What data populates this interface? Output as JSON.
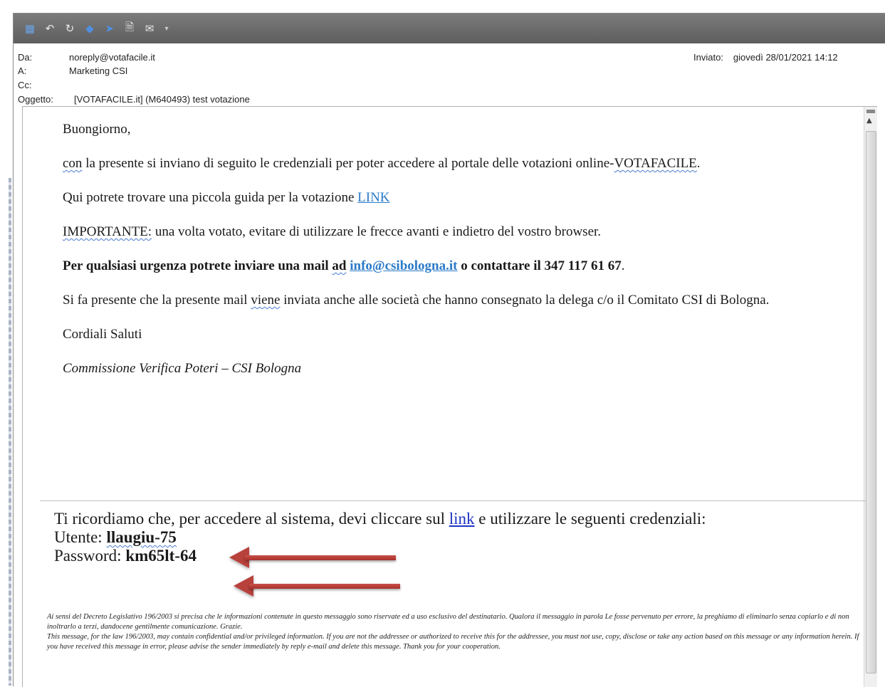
{
  "toolbar": {
    "icons": [
      "save-icon",
      "undo-icon",
      "redo-icon",
      "previous-icon",
      "next-icon",
      "attachment-icon",
      "fax-icon",
      "customize-dropdown-icon"
    ]
  },
  "header": {
    "from_label": "Da:",
    "from_value": "noreply@votafacile.it",
    "to_label": "A:",
    "to_value": "Marketing CSI",
    "cc_label": "Cc:",
    "cc_value": "",
    "subject_label": "Oggetto:",
    "subject_value": "[VOTAFACILE.it] (M640493) test votazione",
    "sent_label": "Inviato:",
    "sent_value": "giovedì 28/01/2021 14:12"
  },
  "message": {
    "greeting": "Buongiorno,",
    "p1_a": "con",
    "p1_b": " la presente si inviano di seguito le credenziali per poter accedere al portale delle votazioni online-",
    "p1_c": "VOTAFACILE",
    "p1_d": ".",
    "p2_a": "Qui potrete trovare una piccola guida per la votazione ",
    "p2_link": "LINK",
    "p3_a": "IMPORTANTE:",
    "p3_b": " una volta votato, evitare di utilizzare  le frecce avanti e indietro  del vostro browser.",
    "p4_a": "Per qualsiasi urgenza potrete inviare una mail ",
    "p4_ad": "ad",
    "p4_space": " ",
    "p4_email": "info@csibologna.it",
    "p4_b": " o contattare il 347 117 61 67",
    "p4_dot": ".",
    "p5_a": "Si fa presente che la presente mail ",
    "p5_viene": "viene",
    "p5_b": " inviata anche alle società che hanno consegnato la delega c/o il Comitato CSI di Bologna.",
    "closing": "Cordiali Saluti",
    "signature": "Commissione Verifica Poteri – CSI Bologna"
  },
  "reminder": {
    "line1_a": "Ti ricordiamo che, per accedere al sistema, devi cliccare sul ",
    "line1_link": "link",
    "line1_b": " e utilizzare le seguenti credenziali:",
    "user_label": "Utente: ",
    "user_value": "llaugiu-75",
    "password_label": "Password: ",
    "password_value": "km65lt-64"
  },
  "disclaimer": {
    "it": "Ai sensi del Decreto Legislativo 196/2003 si precisa che le informazioni contenute in questo messaggio sono riservate ed a uso esclusivo del destinatario. Qualora il messaggio in parola Le fosse pervenuto per errore, la preghiamo di eliminarlo senza copiarlo e di non inoltrarlo a terzi, dandocene gentilmente comunicazione. Grazie.",
    "en": "This message, for the law 196/2003, may contain confidential and/or privileged information. If you are not the addressee or authorized to receive this for the addressee, you must not use, copy, disclose or take any action based on this message or any information herein. If you have received this message in error, please advise the sender immediately by reply e-mail and delete this message. Thank you for your cooperation."
  },
  "colors": {
    "toolbar_bg": "#6b6b6b",
    "link": "#2b7ac8",
    "arrow": "#b8413c"
  }
}
